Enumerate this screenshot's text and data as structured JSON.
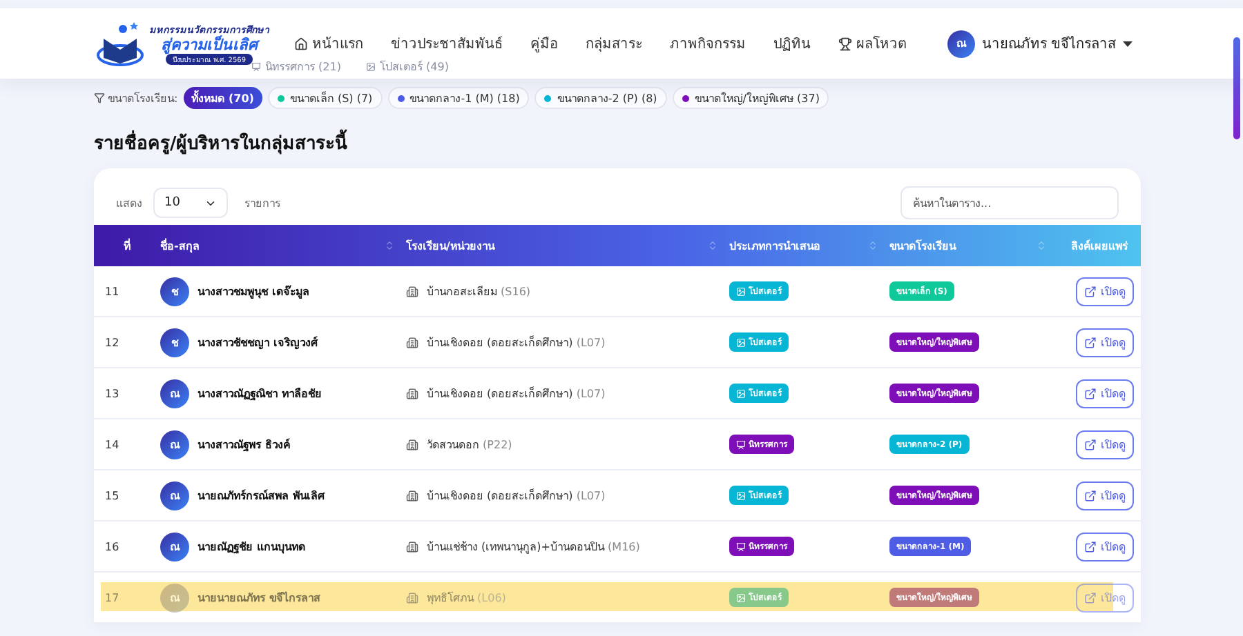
{
  "header": {
    "logo": {
      "line1": "มหกรรมนวัตกรรมการศึกษา",
      "line2": "สู่ความเป็นเลิศ",
      "line3": "ปีงบประมาณ พ.ศ. 2569"
    },
    "nav": [
      {
        "label": "หน้าแรก",
        "kind": "home"
      },
      {
        "label": "ข่าวประชาสัมพันธ์"
      },
      {
        "label": "คู่มือ"
      },
      {
        "label": "กลุ่มสาระ"
      },
      {
        "label": "ภาพกิจกรรม"
      },
      {
        "label": "ปฏิทิน"
      },
      {
        "label": "ผลโหวต",
        "kind": "trophy"
      }
    ],
    "user": {
      "initial": "ณ",
      "name": "นายณภัทร ขจีไกรลาส"
    }
  },
  "hidden_stats": [
    {
      "label": "นิทรรศการ (21)",
      "kind": "exhibit"
    },
    {
      "label": "โปสเตอร์ (49)",
      "kind": "poster"
    }
  ],
  "filter": {
    "label": "ขนาดโรงเรียน:",
    "chips": [
      {
        "label": "ทั้งหมด (70)",
        "selected": true
      },
      {
        "label": "ขนาดเล็ก (S) (7)",
        "selected": false,
        "color": "#10c99a"
      },
      {
        "label": "ขนาดกลาง-1 (M) (18)",
        "selected": false,
        "color": "#4f5ce6"
      },
      {
        "label": "ขนาดกลาง-2 (P) (8)",
        "selected": false,
        "color": "#06b6d4"
      },
      {
        "label": "ขนาดใหญ่/ใหญ่พิเศษ (37)",
        "selected": false,
        "color": "#7e0fb8"
      }
    ]
  },
  "section_title": "รายชื่อครู/ผู้บริหารในกลุ่มสาระนี้",
  "table": {
    "show_label": "แสดง",
    "page_size": "10",
    "entries_label": "รายการ",
    "search": {
      "placeholder": "ค้นหาในตาราง..."
    },
    "columns": [
      {
        "label": "ที่",
        "sortable": false
      },
      {
        "label": "ชื่อ-สกุล",
        "sortable": true
      },
      {
        "label": "โรงเรียน/หน่วยงาน",
        "sortable": true
      },
      {
        "label": "ประเภทการนำเสนอ",
        "sortable": true
      },
      {
        "label": "ขนาดโรงเรียน",
        "sortable": true
      },
      {
        "label": "ลิงค์เผยแพร่",
        "sortable": false
      }
    ],
    "rows": [
      {
        "no": "11",
        "initial": "ช",
        "name": "นางสาวชมพูนุช เดจ๊ะมูล",
        "school": "บ้านกอสะเลียม",
        "code": "(S16)",
        "type": {
          "kind": "poster",
          "label": "โปสเตอร์",
          "color": "#06b6d4"
        },
        "size": {
          "label": "ขนาดเล็ก (S)",
          "color": "#10c99a"
        },
        "link": "เปิดดู",
        "highlighted": false
      },
      {
        "no": "12",
        "initial": "ช",
        "name": "นางสาวชัชชญา เจริญวงศ์",
        "school": "บ้านเชิงดอย (ดอยสะเก็ดศึกษา)",
        "code": "(L07)",
        "type": {
          "kind": "poster",
          "label": "โปสเตอร์",
          "color": "#06b6d4"
        },
        "size": {
          "label": "ขนาดใหญ่/ใหญ่พิเศษ",
          "color": "#7e0fb8"
        },
        "link": "เปิดดู",
        "highlighted": false
      },
      {
        "no": "13",
        "initial": "ณ",
        "name": "นางสาวณัฏฐณิชา ทาลือชัย",
        "school": "บ้านเชิงดอย (ดอยสะเก็ดศึกษา)",
        "code": "(L07)",
        "type": {
          "kind": "poster",
          "label": "โปสเตอร์",
          "color": "#06b6d4"
        },
        "size": {
          "label": "ขนาดใหญ่/ใหญ่พิเศษ",
          "color": "#7e0fb8"
        },
        "link": "เปิดดู",
        "highlighted": false
      },
      {
        "no": "14",
        "initial": "ณ",
        "name": "นางสาวณัฐพร ธิวงค์",
        "school": "วัดสวนดอก",
        "code": "(P22)",
        "type": {
          "kind": "exhibit",
          "label": "นิทรรศการ",
          "color": "#7e0fb8"
        },
        "size": {
          "label": "ขนาดกลาง-2 (P)",
          "color": "#06b6d4"
        },
        "link": "เปิดดู",
        "highlighted": false
      },
      {
        "no": "15",
        "initial": "ณ",
        "name": "นายณภัทร์กรณ์สพล พันเลิศ",
        "school": "บ้านเชิงดอย (ดอยสะเก็ดศึกษา)",
        "code": "(L07)",
        "type": {
          "kind": "poster",
          "label": "โปสเตอร์",
          "color": "#06b6d4"
        },
        "size": {
          "label": "ขนาดใหญ่/ใหญ่พิเศษ",
          "color": "#7e0fb8"
        },
        "link": "เปิดดู",
        "highlighted": false
      },
      {
        "no": "16",
        "initial": "ณ",
        "name": "นายณัฏฐชัย แกนบุนทด",
        "school": "บ้านแช่ช้าง (เทพนานุกูล)+บ้านดอนปิน",
        "code": "(M16)",
        "type": {
          "kind": "exhibit",
          "label": "นิทรรศการ",
          "color": "#7e0fb8"
        },
        "size": {
          "label": "ขนาดกลาง-1 (M)",
          "color": "#4f5ce6"
        },
        "link": "เปิดดู",
        "highlighted": false
      },
      {
        "no": "17",
        "initial": "ณ",
        "name": "นายนายณภัทร ขจีไกรลาส",
        "school": "พุทธิโศภน",
        "code": "(L06)",
        "type": {
          "kind": "poster",
          "label": "โปสเตอร์",
          "color": "#86c98a"
        },
        "size": {
          "label": "ขนาดใหญ่/ใหญ่พิเศษ",
          "color": "#c07a78"
        },
        "link": "เปิดดู",
        "highlighted": true
      }
    ]
  }
}
